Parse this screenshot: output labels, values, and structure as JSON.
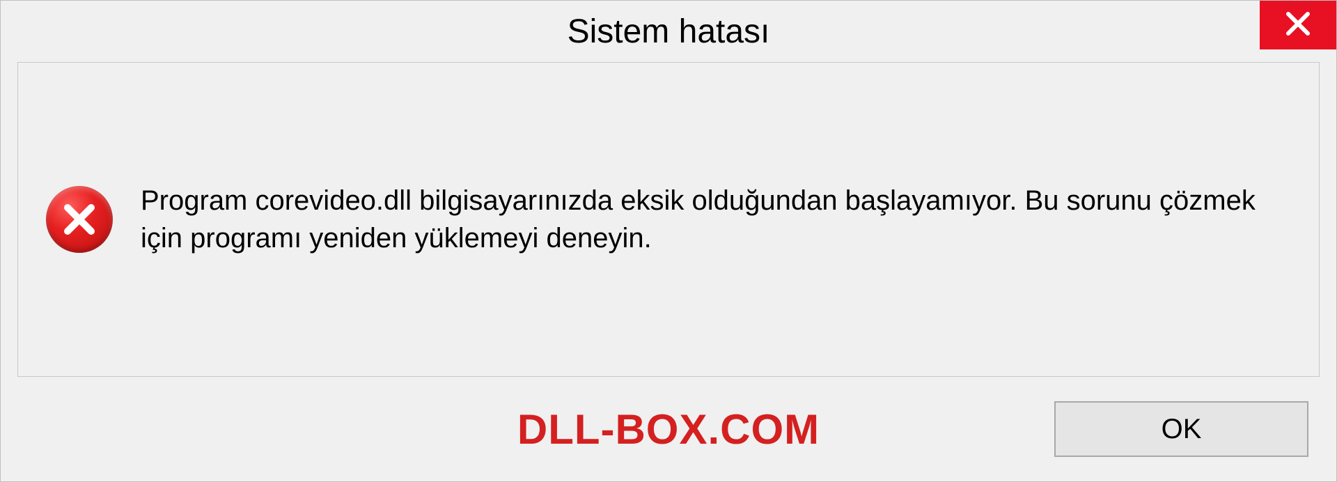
{
  "dialog": {
    "title": "Sistem hatası",
    "message": "Program corevideo.dll bilgisayarınızda eksik olduğundan başlayamıyor. Bu sorunu çözmek için programı yeniden yüklemeyi deneyin.",
    "ok_label": "OK"
  },
  "watermark": "DLL-BOX.COM",
  "colors": {
    "close_bg": "#e81123",
    "error_red": "#d42020"
  }
}
